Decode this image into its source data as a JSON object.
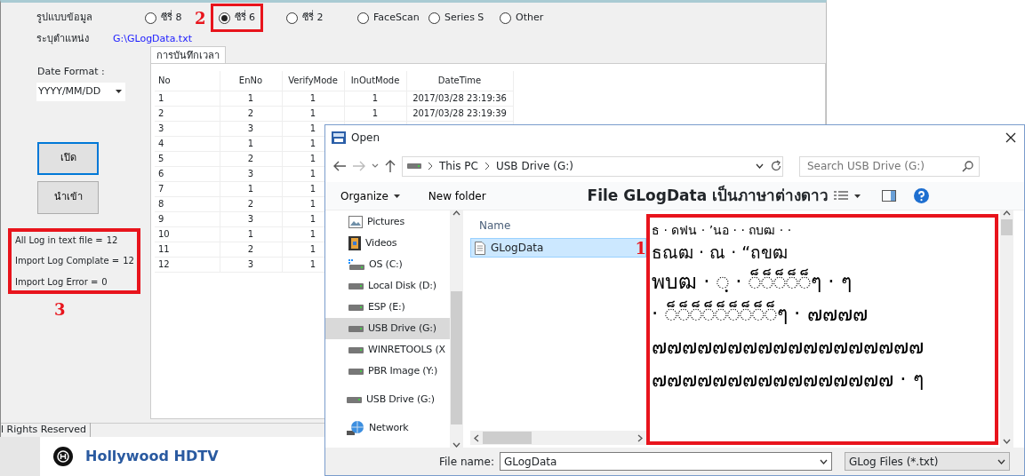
{
  "app": {
    "format_label": "รูปแบบข้อมูล",
    "format_options": [
      {
        "label": "ซีรี่ 8",
        "selected": false,
        "highlighted": false
      },
      {
        "label": "ซีรี่ 6",
        "selected": true,
        "highlighted": true,
        "marker": "2"
      },
      {
        "label": "ซีรี่ 2",
        "selected": false,
        "highlighted": false
      },
      {
        "label": "FaceScan",
        "selected": false,
        "highlighted": false
      },
      {
        "label": "Series S",
        "selected": false,
        "highlighted": false
      },
      {
        "label": "Other",
        "selected": false,
        "highlighted": false
      }
    ],
    "path_label": "ระบุตำแหน่ง",
    "path": "G:\\GLogData.txt",
    "date_format_label": "Date Format :",
    "date_format": "YYYY/MM/DD",
    "buttons": [
      {
        "label": "เปิด",
        "focused": true
      },
      {
        "label": "นำเข้า",
        "focused": false
      }
    ],
    "stats": {
      "marker": "3",
      "items": [
        {
          "label": "All Log in text file =",
          "value": "12"
        },
        {
          "label": "Import Log Complate =",
          "value": "12"
        },
        {
          "label": "Import Log Error =",
          "value": "0"
        }
      ]
    },
    "tab": "การบันทึกเวลา",
    "table": {
      "columns": [
        "No",
        "EnNo",
        "VerifyMode",
        "InOutMode",
        "DateTime"
      ],
      "rows": [
        [
          "1",
          "1",
          "1",
          "1",
          "2017/03/28 23:19:36"
        ],
        [
          "2",
          "2",
          "1",
          "1",
          "2017/03/28 23:19:39"
        ],
        [
          "3",
          "3",
          "1"
        ],
        [
          "4",
          "1",
          "1"
        ],
        [
          "5",
          "2",
          "1"
        ],
        [
          "6",
          "3",
          "1"
        ],
        [
          "7",
          "1",
          "1"
        ],
        [
          "8",
          "2",
          "1"
        ],
        [
          "9",
          "3",
          "1"
        ],
        [
          "10",
          "1",
          "1"
        ],
        [
          "11",
          "2",
          "1"
        ],
        [
          "12",
          "3",
          "1"
        ]
      ]
    },
    "status_bar": "l Rights Reserved"
  },
  "web": {
    "title": "Hollywood HDTV"
  },
  "dialog": {
    "title": "Open",
    "address": [
      "This PC",
      "USB Drive (G:)"
    ],
    "search": {
      "placeholder": "Search USB Drive (G:)"
    },
    "toolbar": [
      "Organize",
      "New folder"
    ],
    "note": "File GLogData เป็นภาษาต่างดาว",
    "nav_sub_items": [
      {
        "label": "Pictures",
        "kind": "pictures",
        "selected": false
      },
      {
        "label": "Videos",
        "kind": "videos",
        "selected": false
      },
      {
        "label": "OS (C:)",
        "kind": "system",
        "selected": false
      },
      {
        "label": "Local Disk (D:)",
        "kind": "drive",
        "selected": false
      },
      {
        "label": "ESP (E:)",
        "kind": "drive",
        "selected": false
      },
      {
        "label": "USB Drive (G:)",
        "kind": "drive",
        "selected": true
      },
      {
        "label": "WINRETOOLS (X",
        "kind": "drive",
        "selected": false
      },
      {
        "label": "PBR Image (Y:)",
        "kind": "drive",
        "selected": false
      }
    ],
    "nav_items": [
      {
        "label": "USB Drive (G:)",
        "kind": "drive",
        "selected": false
      },
      {
        "label": "Network",
        "kind": "network",
        "selected": false
      }
    ],
    "file_column": "Name",
    "files": [
      {
        "name": "GLogData",
        "selected": true,
        "marker": "1"
      }
    ],
    "preview_lines": [
      "ธ · ดฟน · ’นอ ·  · ถบฒ ·  ·",
      "ธณฒ · ณ · “ถขฒ",
      "พบฒ · ◌ฺ · ◌็◌็◌็◌็◌็ๆ · ๆ",
      " · ◌็◌็◌็◌็◌็◌็◌็◌็◌็ๆ · ๗๗๗๗",
      "๗๗๗๗๗๗๗๗๗๗๗๗๗๗๗๗๗๗",
      "๗๗๗๗๗๗๗๗๗๗๗๗๗๗๗๗ · ๆ"
    ],
    "filename_label": "File name:",
    "filename": "GLogData",
    "filetype": "GLog Files (*.txt)"
  }
}
